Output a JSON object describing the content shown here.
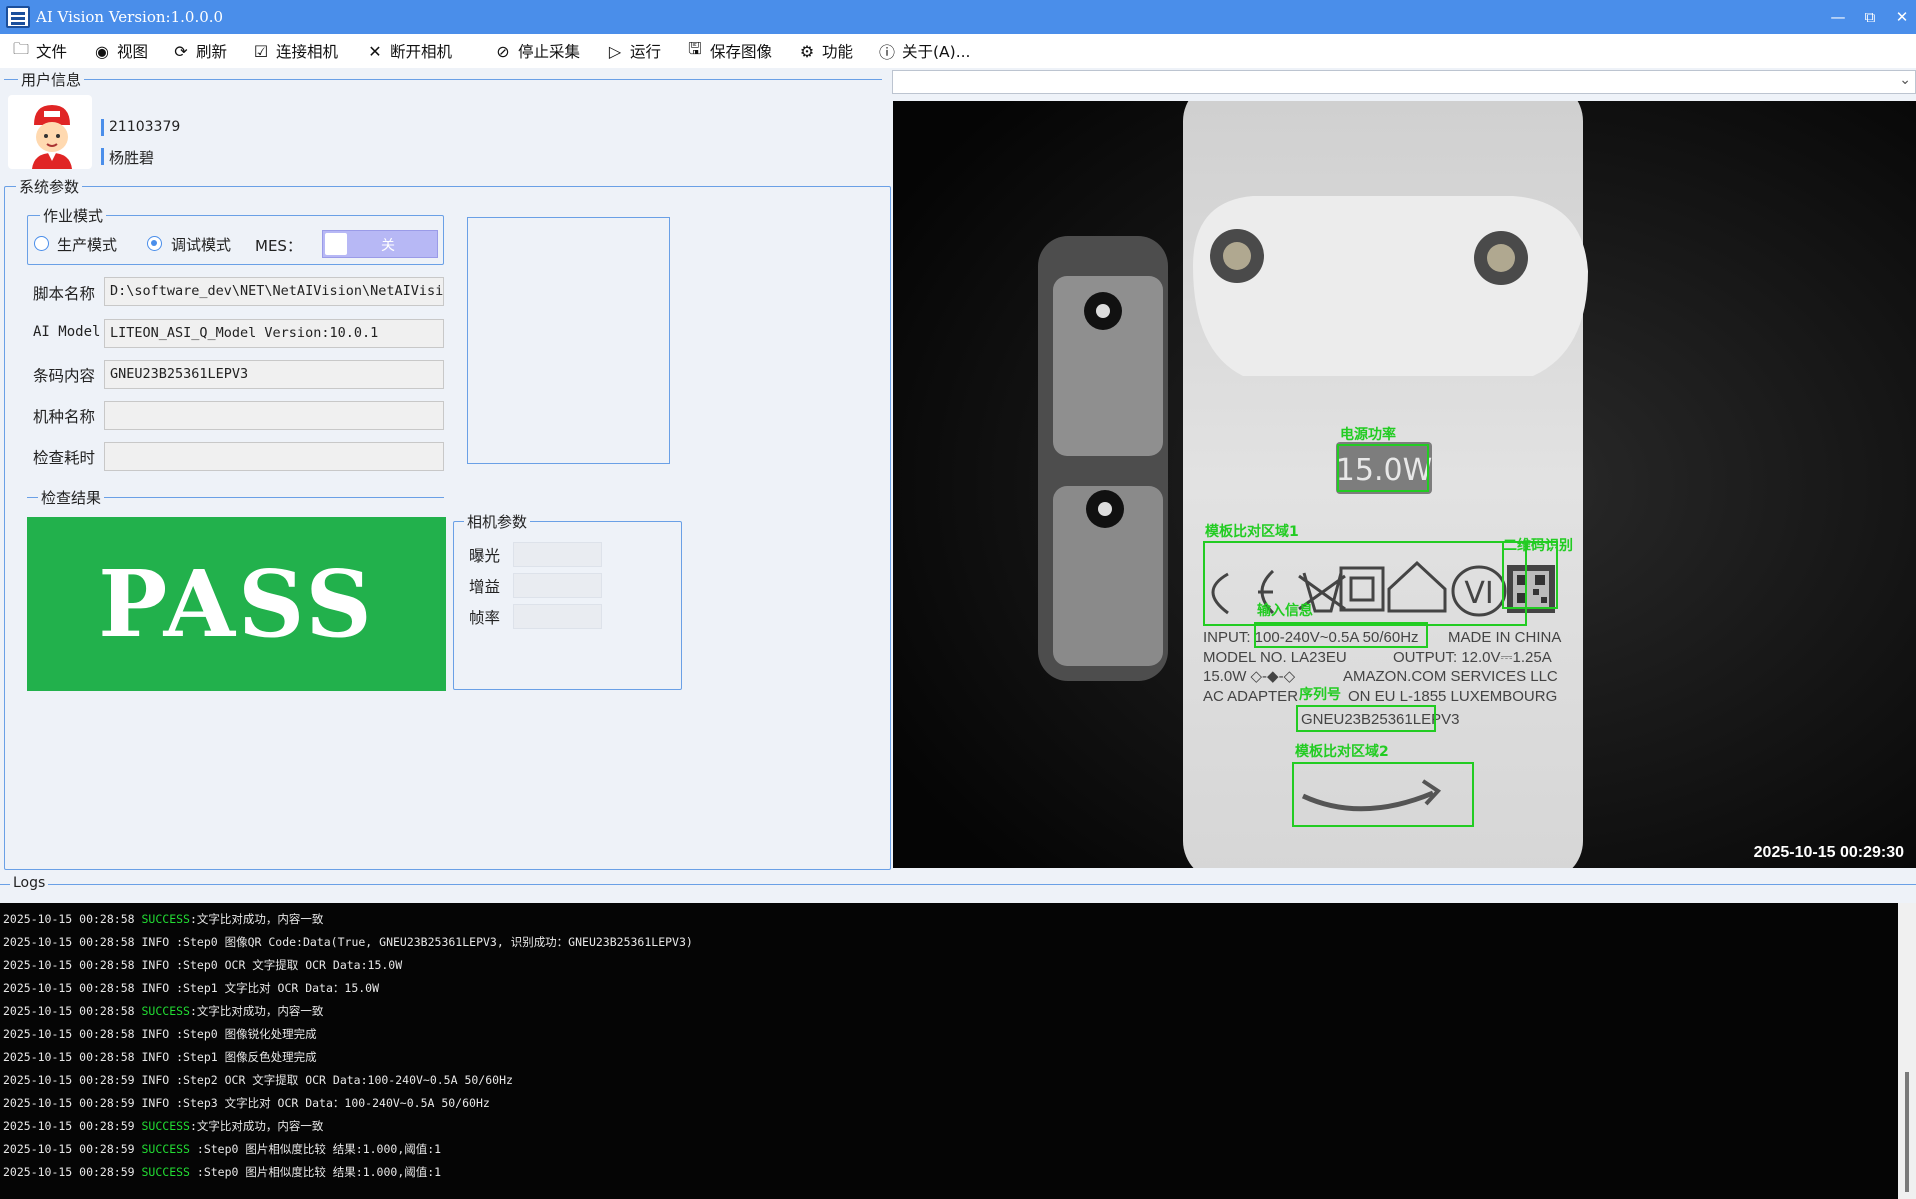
{
  "window": {
    "title": "AI Vision Version:1.0.0.0",
    "minimize_icon": "minimize-icon",
    "restore_icon": "restore-icon",
    "close_icon": "close-icon"
  },
  "menu": [
    {
      "label": "文件",
      "icon": "folder-icon"
    },
    {
      "label": "视图",
      "icon": "eye-icon"
    },
    {
      "label": "刷新",
      "icon": "refresh-icon"
    },
    {
      "label": "连接相机",
      "icon": "checkbox-icon"
    },
    {
      "label": "断开相机",
      "icon": "disconnect-icon"
    },
    {
      "label": "停止采集",
      "icon": "stop-icon"
    },
    {
      "label": "运行",
      "icon": "play-icon"
    },
    {
      "label": "保存图像",
      "icon": "save-icon"
    },
    {
      "label": "功能",
      "icon": "gear-icon"
    },
    {
      "label": "关于(A)...",
      "icon": "info-icon"
    }
  ],
  "user_info": {
    "section": "用户信息",
    "id": "21103379",
    "name": "杨胜碧"
  },
  "system_params": {
    "section": "系统参数",
    "mode_section": "作业模式",
    "mode_production": "生产模式",
    "mode_debug": "调试模式",
    "selected_mode": "调试模式",
    "mes_label": "MES：",
    "mes_toggle": "关",
    "fields": [
      {
        "label": "脚本名称",
        "value": "D:\\software_dev\\NET\\NetAIVision\\NetAIVisi"
      },
      {
        "label": "AI Model",
        "value": "LITEON_ASI_Q_Model Version:10.0.1"
      },
      {
        "label": "条码内容",
        "value": "GNEU23B25361LEPV3"
      },
      {
        "label": "机种名称",
        "value": ""
      },
      {
        "label": "检查耗时",
        "value": ""
      }
    ]
  },
  "result": {
    "section": "检查结果",
    "value": "PASS",
    "color": "#22b14c"
  },
  "camera_params": {
    "section": "相机参数",
    "exposure_label": "曝光",
    "gain_label": "增益",
    "fps_label": "帧率",
    "exposure": "",
    "gain": "",
    "fps": ""
  },
  "camera_select": {
    "value": ""
  },
  "camera": {
    "timestamp": "2025-10-15 00:29:30",
    "roi_labels": {
      "power": "电源功率",
      "template1": "模板比对区域1",
      "qr": "二维码识别",
      "input": "输入信息",
      "serial": "序列号",
      "template2": "模板比对区域2"
    },
    "label_text": {
      "power": "15.0W",
      "input": "INPUT: 100-240V~0.5A 50/60Hz",
      "made": "MADE IN CHINA",
      "model": "MODEL NO. LA23EU",
      "output": "OUTPUT: 12.0V⎓1.25A",
      "watt": "15.0W ◇-◆-◇",
      "amazon": "AMAZON.COM SERVICES LLC",
      "adapter": "AC ADAPTER",
      "address": "ON EU L-1855 LUXEMBOURG",
      "serial": "GNEU23B25361LEPV3"
    },
    "roi_color": "#22cc22"
  },
  "logs": {
    "section": "Logs",
    "lines": [
      {
        "ts": "2025-10-15 00:28:58",
        "level": "SUCCESS",
        "msg": ":文字比对成功，内容一致"
      },
      {
        "ts": "2025-10-15 00:28:58",
        "level": "INFO",
        "msg": " :Step0 图像QR Code:Data(True, GNEU23B25361LEPV3, 识别成功：GNEU23B25361LEPV3)"
      },
      {
        "ts": "2025-10-15 00:28:58",
        "level": "INFO",
        "msg": " :Step0 OCR 文字提取 OCR Data:15.0W"
      },
      {
        "ts": "2025-10-15 00:28:58",
        "level": "INFO",
        "msg": " :Step1 文字比对 OCR Data：15.0W"
      },
      {
        "ts": "2025-10-15 00:28:58",
        "level": "SUCCESS",
        "msg": ":文字比对成功，内容一致"
      },
      {
        "ts": "2025-10-15 00:28:58",
        "level": "INFO",
        "msg": " :Step0 图像锐化处理完成"
      },
      {
        "ts": "2025-10-15 00:28:58",
        "level": "INFO",
        "msg": " :Step1 图像反色处理完成"
      },
      {
        "ts": "2025-10-15 00:28:59",
        "level": "INFO",
        "msg": " :Step2 OCR 文字提取 OCR Data:100-240V~0.5A 50/60Hz"
      },
      {
        "ts": "2025-10-15 00:28:59",
        "level": "INFO",
        "msg": " :Step3 文字比对 OCR Data：100-240V~0.5A 50/60Hz"
      },
      {
        "ts": "2025-10-15 00:28:59",
        "level": "SUCCESS",
        "msg": ":文字比对成功，内容一致"
      },
      {
        "ts": "2025-10-15 00:28:59",
        "level": "SUCCESS",
        "msg": " :Step0 图片相似度比较 结果:1.000,阈值:1"
      },
      {
        "ts": "2025-10-15 00:28:59",
        "level": "SUCCESS",
        "msg": " :Step0 图片相似度比较 结果:1.000,阈值:1"
      }
    ]
  }
}
